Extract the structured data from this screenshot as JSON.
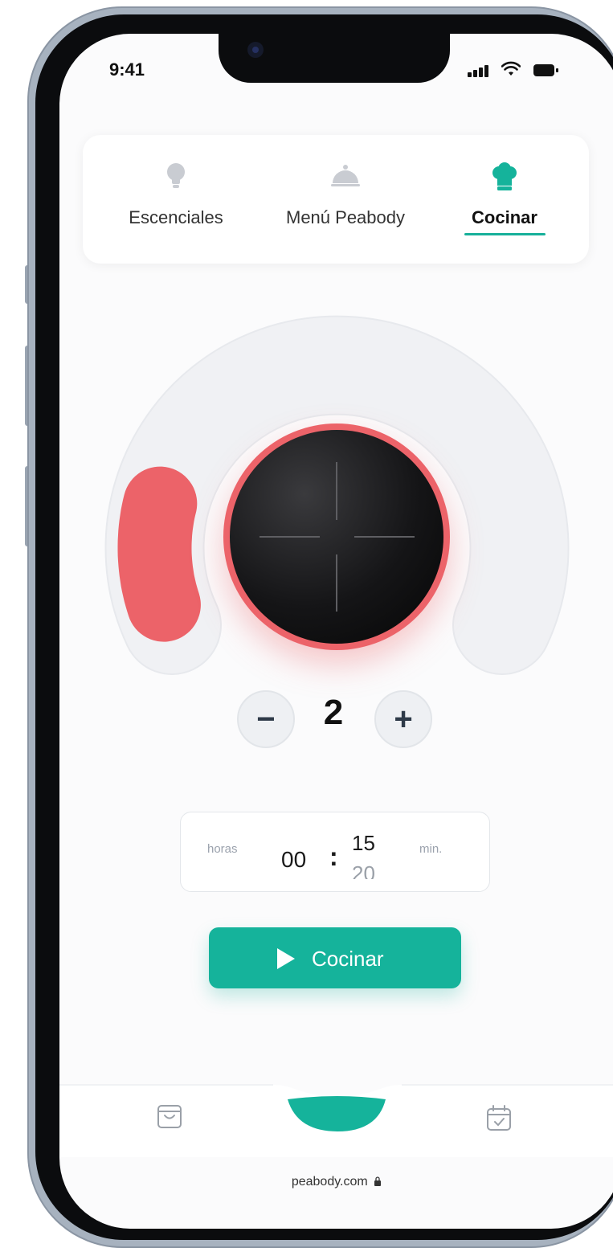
{
  "status_bar": {
    "time": "9:41"
  },
  "tabs": [
    {
      "label": "Escenciales",
      "icon": "lightbulb-icon",
      "active": false
    },
    {
      "label": "Menú Peabody",
      "icon": "cloche-icon",
      "active": false
    },
    {
      "label": "Cocinar",
      "icon": "chef-hat-icon",
      "active": true
    }
  ],
  "dial": {
    "level": 2,
    "level_fraction": 0.17
  },
  "stepper": {
    "minus": "−",
    "value": "2",
    "plus": "+"
  },
  "timer": {
    "hours_label": "horas",
    "hours": "00",
    "separator": ":",
    "minutes": "15",
    "minutes_next": "20",
    "minutes_label": "min."
  },
  "cook_button": {
    "label": "Cocinar"
  },
  "bottom_nav": {
    "left_icon": "shopping-bag-icon",
    "right_icon": "calendar-check-icon"
  },
  "browser": {
    "url": "peabody.com"
  },
  "colors": {
    "accent": "#15b39b",
    "heat": "#ec6369",
    "knob": "#111111"
  }
}
